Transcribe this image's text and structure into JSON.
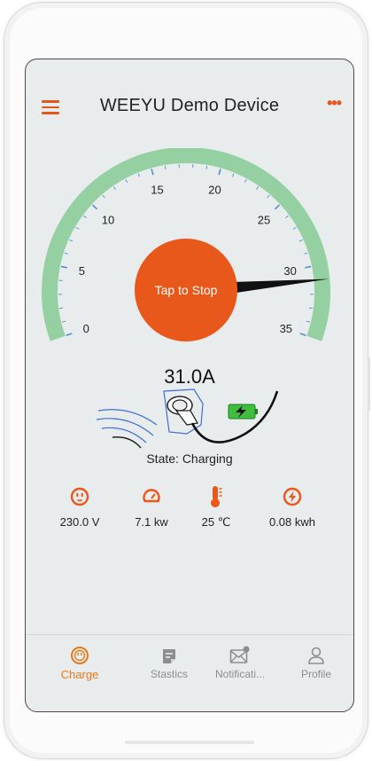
{
  "header": {
    "title": "WEEYU Demo Device",
    "menu_icon": "hamburger-menu-icon",
    "more_icon": "more-options-icon"
  },
  "gauge": {
    "min": 0,
    "max": 35,
    "value": 31.0,
    "tick_labels": [
      "0",
      "5",
      "10",
      "15",
      "20",
      "25",
      "30",
      "35"
    ],
    "stop_button_label": "Tap to Stop",
    "colors": {
      "arc": "#95d0a3",
      "ticks": "#4a90d9",
      "needle": "#111111",
      "button": "#e8581a"
    }
  },
  "status": {
    "current": "31.0A",
    "state": "State: Charging"
  },
  "stats": [
    {
      "icon": "outlet-icon",
      "value": "230.0 V"
    },
    {
      "icon": "speedometer-icon",
      "value": "7.1 kw"
    },
    {
      "icon": "thermometer-icon",
      "value": "25 ℃"
    },
    {
      "icon": "energy-bolt-icon",
      "value": "0.08 kwh"
    }
  ],
  "nav": [
    {
      "icon": "charge-icon",
      "label": "Charge",
      "active": true
    },
    {
      "icon": "statistics-icon",
      "label": "Stastics",
      "active": false
    },
    {
      "icon": "notification-icon",
      "label": "Notificati...",
      "active": false
    },
    {
      "icon": "profile-icon",
      "label": "Profile",
      "active": false
    }
  ],
  "accent_color": "#e8581a"
}
